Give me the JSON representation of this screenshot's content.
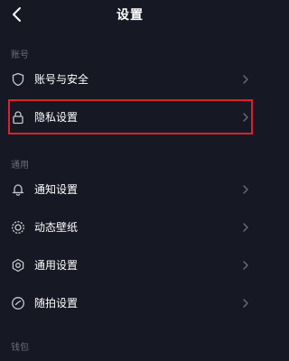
{
  "header": {
    "title": "设置",
    "back_icon": "chevron-left-icon"
  },
  "sections": [
    {
      "title": "账号",
      "items": [
        {
          "label": "账号与安全",
          "icon": "shield-icon"
        },
        {
          "label": "隐私设置",
          "icon": "lock-icon",
          "highlighted": true
        }
      ]
    },
    {
      "title": "通用",
      "items": [
        {
          "label": "通知设置",
          "icon": "bell-icon"
        },
        {
          "label": "动态壁纸",
          "icon": "wallpaper-icon"
        },
        {
          "label": "通用设置",
          "icon": "gear-icon"
        },
        {
          "label": "随拍设置",
          "icon": "check-circle-icon"
        }
      ]
    },
    {
      "title": "钱包",
      "items": []
    }
  ],
  "colors": {
    "background": "#161823",
    "text": "#ffffff",
    "section_text": "#6b6d78",
    "icon": "#c8c9cf",
    "chevron": "#6b6d78",
    "highlight": "#e01f2d"
  }
}
